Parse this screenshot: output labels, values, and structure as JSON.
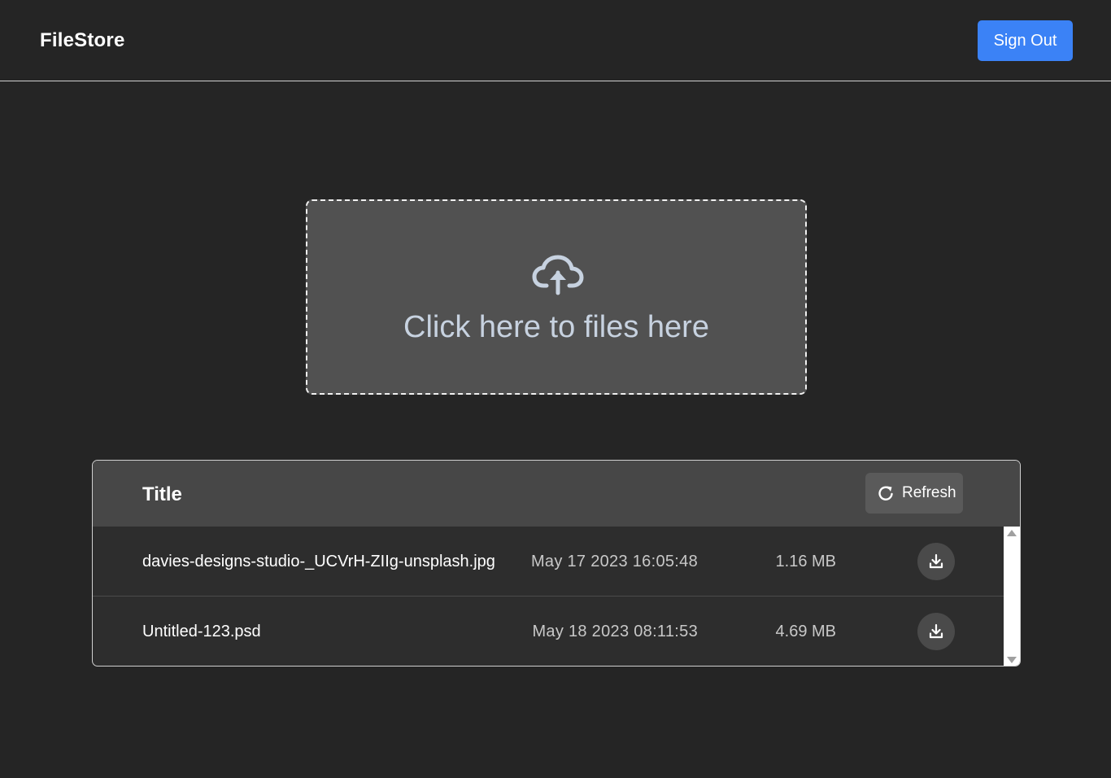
{
  "header": {
    "brand": "FileStore",
    "sign_out_label": "Sign Out"
  },
  "upload": {
    "text": "Click here to files here",
    "icon": "cloud-upload-icon"
  },
  "files": {
    "title": "Title",
    "refresh_label": "Refresh",
    "rows": [
      {
        "name": "davies-designs-studio-_UCVrH-ZIIg-unsplash.jpg",
        "date": "May 17 2023 16:05:48",
        "size": "1.16 MB"
      },
      {
        "name": "Untitled-123.psd",
        "date": "May 18 2023 08:11:53",
        "size": "4.69 MB"
      }
    ]
  },
  "colors": {
    "background": "#252525",
    "accent": "#3b82f6",
    "dropzone": "#515151",
    "table_header": "#474747"
  }
}
